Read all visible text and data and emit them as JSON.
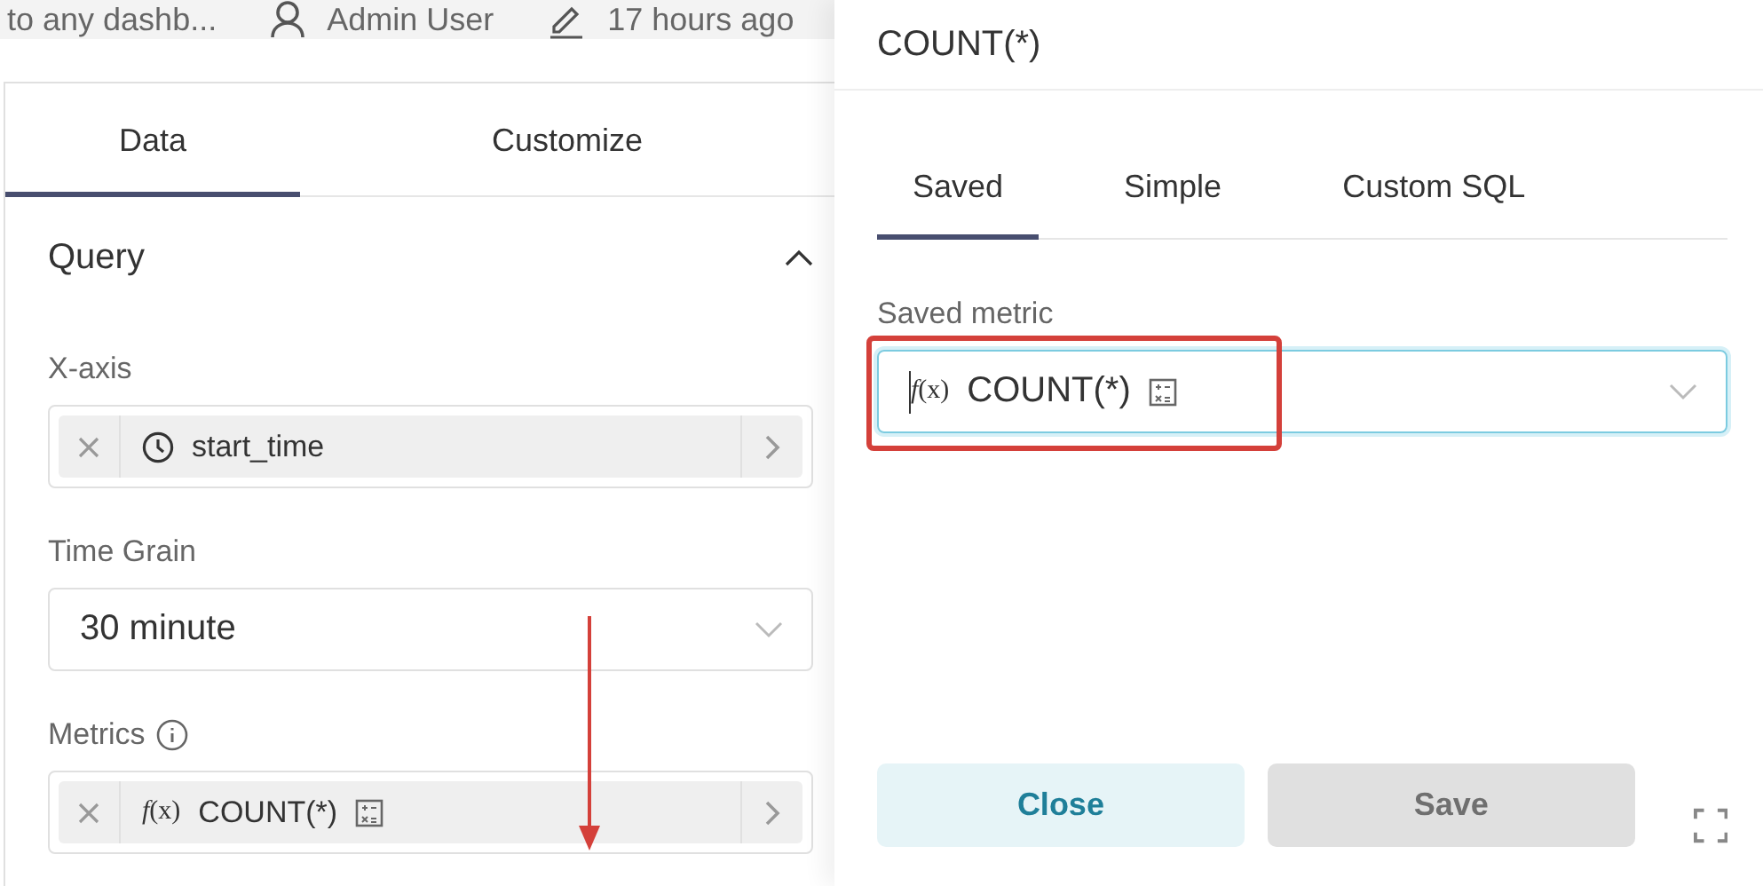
{
  "header": {
    "items": [
      {
        "kind": "text",
        "text": "to any dashb..."
      },
      {
        "kind": "user",
        "text": "Admin User"
      },
      {
        "kind": "edited",
        "text": "17 hours ago"
      }
    ]
  },
  "panel_tabs": [
    {
      "label": "Data",
      "selected": true
    },
    {
      "label": "Customize",
      "selected": false
    }
  ],
  "section": {
    "title": "Query",
    "expanded": true
  },
  "fields": [
    {
      "kind": "pill",
      "label": "X-axis",
      "info": false,
      "value": {
        "kind": "column",
        "text": "start_time"
      }
    },
    {
      "kind": "select",
      "label": "Time Grain",
      "info": false,
      "value": "30 minute"
    },
    {
      "kind": "pill",
      "label": "Metrics",
      "info": true,
      "value": {
        "kind": "metric",
        "prefix": "*f*(x)",
        "text": "COUNT(*)"
      }
    }
  ],
  "popover": {
    "title": "COUNT(*)",
    "tabs": [
      {
        "label": "Saved",
        "selected": true
      },
      {
        "label": "Simple",
        "selected": false
      },
      {
        "label": "Custom SQL",
        "selected": false
      }
    ],
    "field": {
      "label": "Saved metric",
      "prefix": "*f*(x)",
      "value": "COUNT(*)",
      "focused": true
    },
    "buttons": [
      {
        "label": "Close",
        "kind": "secondary"
      },
      {
        "label": "Save",
        "kind": "disabled"
      }
    ]
  }
}
